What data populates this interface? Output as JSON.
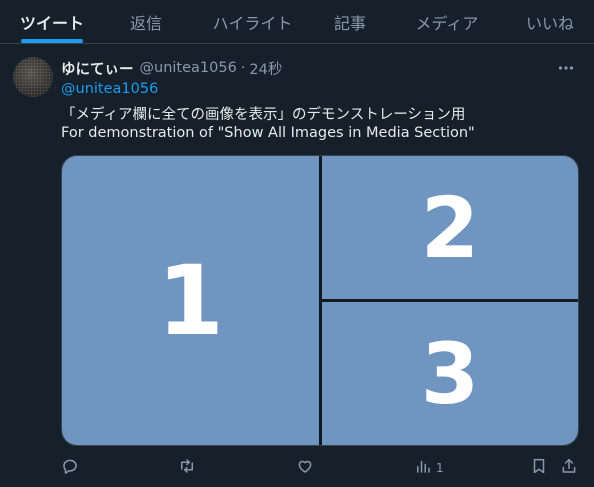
{
  "tabs": [
    {
      "label": "ツイート",
      "active": true
    },
    {
      "label": "返信",
      "active": false
    },
    {
      "label": "ハイライト",
      "active": false
    },
    {
      "label": "記事",
      "active": false
    },
    {
      "label": "メディア",
      "active": false
    },
    {
      "label": "いいね",
      "active": false
    }
  ],
  "tweet": {
    "display_name": "ゆにてぃー",
    "handle": "@unitea1056",
    "separator": "·",
    "time": "24秒",
    "reply_to": "@unitea1056",
    "text_line1": "「メディア欄に全ての画像を表示」のデモンストレーション用",
    "text_line2": "For demonstration of \"Show All Images in Media Section\"",
    "media": [
      "1",
      "2",
      "3"
    ],
    "view_count": "1"
  },
  "colors": {
    "background": "#15202b",
    "accent": "#1d9bf0",
    "media_fill": "#7095c1",
    "muted_text": "#8b98a5"
  },
  "icons": [
    "more-icon",
    "reply-icon",
    "retweet-icon",
    "like-icon",
    "views-icon",
    "bookmark-icon",
    "share-icon"
  ]
}
